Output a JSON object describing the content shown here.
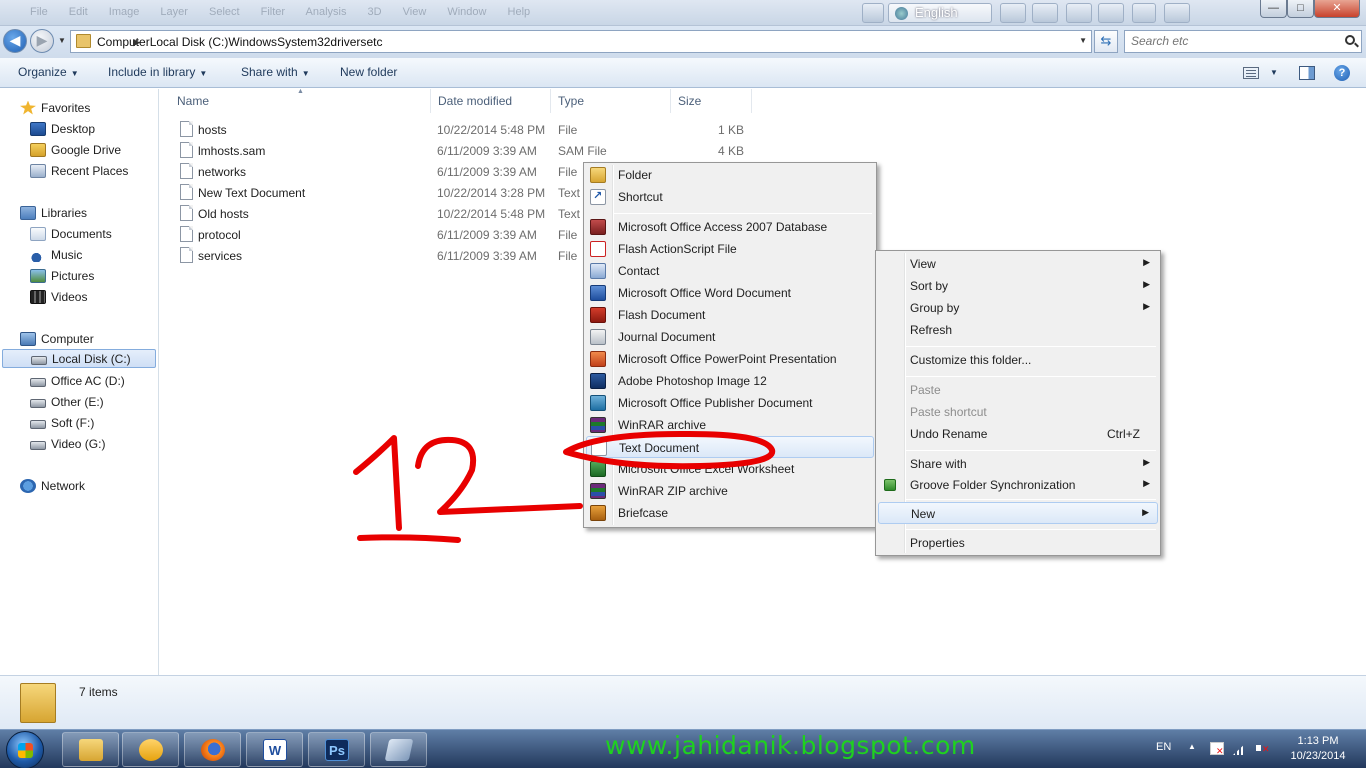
{
  "titlebar": {
    "ghost_menu": "File  Edit  Image  Layer  Select  Filter  Analysis  3D  View  Window  Help",
    "language": "English",
    "minimize": "—",
    "maximize": "□",
    "close": "✕"
  },
  "address": {
    "crumbs": [
      "Computer",
      "Local Disk (C:)",
      "Windows",
      "System32",
      "drivers",
      "etc"
    ],
    "search_placeholder": "Search etc"
  },
  "commandbar": {
    "organize": "Organize",
    "include_in_library": "Include in library",
    "share_with": "Share with",
    "new_folder": "New folder"
  },
  "navpane": {
    "favorites": "Favorites",
    "desktop": "Desktop",
    "google_drive": "Google Drive",
    "recent_places": "Recent Places",
    "libraries": "Libraries",
    "documents": "Documents",
    "music": "Music",
    "pictures": "Pictures",
    "videos": "Videos",
    "computer": "Computer",
    "local_disk": "Local Disk (C:)",
    "office_ac": "Office AC (D:)",
    "other": "Other (E:)",
    "soft": "Soft (F:)",
    "video": "Video (G:)",
    "network": "Network"
  },
  "columns": {
    "name": "Name",
    "date_modified": "Date modified",
    "type": "Type",
    "size": "Size"
  },
  "files": [
    {
      "name": "hosts",
      "date": "10/22/2014 5:48 PM",
      "type": "File",
      "size": "1 KB"
    },
    {
      "name": "lmhosts.sam",
      "date": "6/11/2009 3:39 AM",
      "type": "SAM File",
      "size": "4 KB"
    },
    {
      "name": "networks",
      "date": "6/11/2009 3:39 AM",
      "type": "File",
      "size": ""
    },
    {
      "name": "New Text Document",
      "date": "10/22/2014 3:28 PM",
      "type": "Text",
      "size": ""
    },
    {
      "name": "Old hosts",
      "date": "10/22/2014 5:48 PM",
      "type": "Text",
      "size": ""
    },
    {
      "name": "protocol",
      "date": "6/11/2009 3:39 AM",
      "type": "File",
      "size": ""
    },
    {
      "name": "services",
      "date": "6/11/2009 3:39 AM",
      "type": "File",
      "size": ""
    }
  ],
  "new_submenu": {
    "folder": "Folder",
    "shortcut": "Shortcut",
    "access": "Microsoft Office Access 2007 Database",
    "flash_as": "Flash ActionScript File",
    "contact": "Contact",
    "word": "Microsoft Office Word Document",
    "flash_doc": "Flash Document",
    "journal": "Journal Document",
    "powerpoint": "Microsoft Office PowerPoint Presentation",
    "photoshop": "Adobe Photoshop Image 12",
    "publisher": "Microsoft Office Publisher Document",
    "winrar": "WinRAR archive",
    "text": "Text Document",
    "excel": "Microsoft Office Excel Worksheet",
    "winrar_zip": "WinRAR ZIP archive",
    "briefcase": "Briefcase"
  },
  "context_menu": {
    "view": "View",
    "sort_by": "Sort by",
    "group_by": "Group by",
    "refresh": "Refresh",
    "customize": "Customize this folder...",
    "paste": "Paste",
    "paste_shortcut": "Paste shortcut",
    "undo_rename": "Undo Rename",
    "undo_shortcut": "Ctrl+Z",
    "share_with": "Share with",
    "groove": "Groove Folder Synchronization",
    "new": "New",
    "properties": "Properties"
  },
  "status": {
    "items": "7 items"
  },
  "taskbar": {
    "watermark": "www.jahidanik.blogspot.com",
    "lang": "EN",
    "time": "1:13 PM",
    "date": "10/23/2014",
    "word_letter": "W",
    "ps_letter": "Ps"
  },
  "annotation": {
    "number": "12",
    "color": "#e80000"
  }
}
